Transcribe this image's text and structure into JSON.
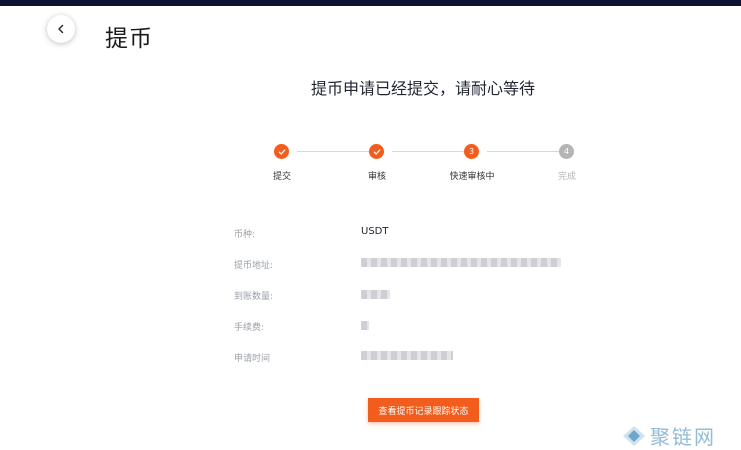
{
  "header": {
    "title": "提币"
  },
  "headline": "提币申请已经提交，请耐心等待",
  "steps": [
    {
      "label": "提交",
      "state": "done"
    },
    {
      "label": "审核",
      "state": "done"
    },
    {
      "label": "快速审核中",
      "state": "active",
      "number": "3"
    },
    {
      "label": "完成",
      "state": "pending",
      "number": "4"
    }
  ],
  "details": {
    "currency_label": "币种:",
    "currency_value": "USDT",
    "address_label": "提币地址:",
    "amount_label": "到账数量:",
    "fee_label": "手续费:",
    "time_label": "申请时间"
  },
  "action_button": "查看提币记录跟踪状态",
  "watermark": "聚链网",
  "colors": {
    "accent": "#f25c1c",
    "pending": "#b5b5b5",
    "topbar": "#0e1530"
  }
}
